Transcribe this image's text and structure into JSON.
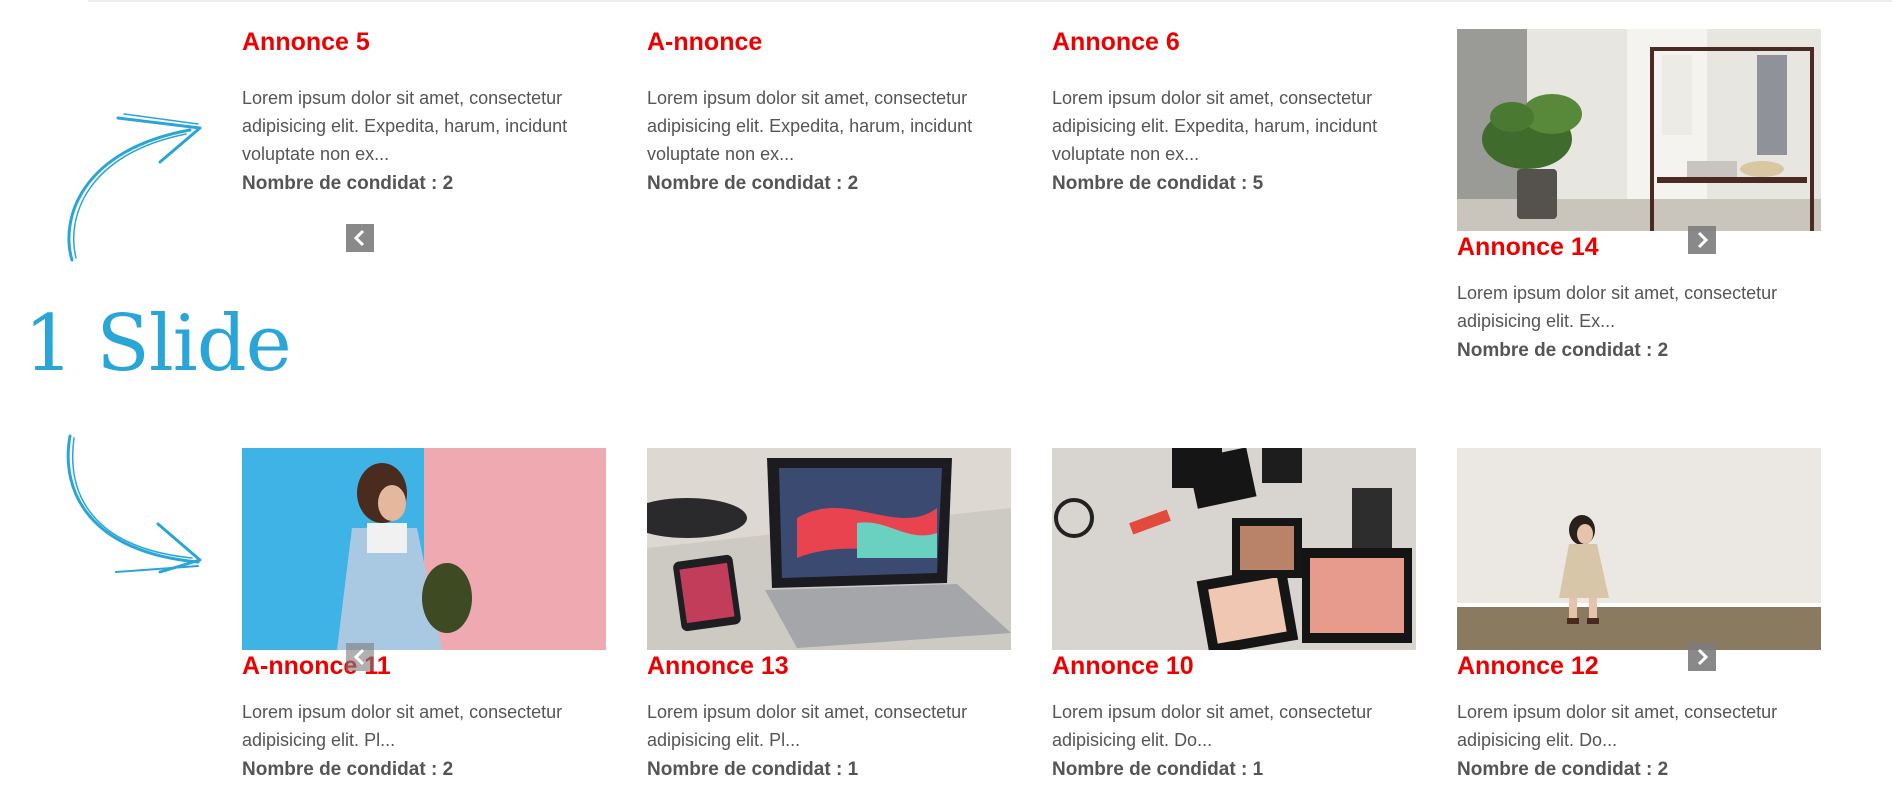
{
  "annotation": {
    "label": "1 Slide"
  },
  "slide_1": {
    "cards": [
      {
        "title": "Annonce 5",
        "text": "Lorem ipsum dolor sit amet, consectetur adipisicing elit. Expedita, harum, incidunt voluptate non ex...",
        "count": "Nombre de condidat : 2"
      },
      {
        "title": "A-nnonce",
        "text": "Lorem ipsum dolor sit amet, consectetur adipisicing elit. Expedita, harum, incidunt voluptate non ex...",
        "count": "Nombre de condidat : 2"
      },
      {
        "title": "Annonce 6",
        "text": "Lorem ipsum dolor sit amet, consectetur adipisicing elit. Expedita, harum, incidunt voluptate non ex...",
        "count": "Nombre de condidat : 5"
      },
      {
        "title": "Annonce 14",
        "text": "Lorem ipsum dolor sit amet, consectetur adipisicing elit. Ex...",
        "count": "Nombre de condidat : 2",
        "image": "clothing-rack-photo"
      }
    ],
    "prev_icon": "chevron-left-icon",
    "next_icon": "chevron-right-icon"
  },
  "slide_2": {
    "cards": [
      {
        "title": "A-nnonce 11",
        "text": "Lorem ipsum dolor sit amet, consectetur adipisicing elit. Pl...",
        "count": "Nombre de condidat : 2",
        "image": "woman-denim-jacket-photo"
      },
      {
        "title": "Annonce 13",
        "text": "Lorem ipsum dolor sit amet, consectetur adipisicing elit. Pl...",
        "count": "Nombre de condidat : 1",
        "image": "laptop-drone-photo"
      },
      {
        "title": "Annonce 10",
        "text": "Lorem ipsum dolor sit amet, consectetur adipisicing elit. Do...",
        "count": "Nombre de condidat : 1",
        "image": "makeup-palettes-photo"
      },
      {
        "title": "Annonce 12",
        "text": "Lorem ipsum dolor sit amet, consectetur adipisicing elit. Do...",
        "count": "Nombre de condidat : 2",
        "image": "child-standing-photo"
      }
    ],
    "prev_icon": "chevron-left-icon",
    "next_icon": "chevron-right-icon"
  },
  "colors": {
    "title": "#ee0000",
    "text": "#555555",
    "annotation": "#2aa5d8",
    "nav": "#7d7d7d"
  }
}
